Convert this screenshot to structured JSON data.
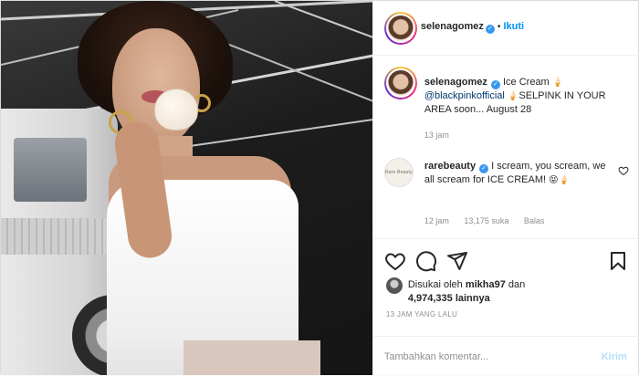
{
  "photo": {
    "alt_icon": "post-photo"
  },
  "header": {
    "username": "selenagomez",
    "verified_icon": "verified-badge-icon",
    "separator": "•",
    "follow_label": "Ikuti"
  },
  "caption": {
    "username": "selenagomez",
    "text_part1": "Ice Cream",
    "emoji1": "🍦",
    "mention": "@blackpinkofficial",
    "emoji2": "🍦",
    "text_part2": "SELPINK IN YOUR AREA soon... August 28",
    "time": "13 jam"
  },
  "comment": {
    "avatar_text": "Rare Beauty",
    "username": "rarebeauty",
    "text": "I scream, you scream, we all scream for ICE CREAM!",
    "emoji": "😝🍦",
    "time": "12 jam",
    "likes": "13,175 suka",
    "reply_label": "Balas"
  },
  "likes": {
    "prefix": "Disukai oleh",
    "user": "mikha97",
    "conjunction": "dan",
    "count": "4,974,335 lainnya"
  },
  "time_ago": "13 JAM YANG LALU",
  "add_comment": {
    "placeholder": "Tambahkan komentar...",
    "post_label": "Kirim"
  },
  "colors": {
    "accent": "#0095f6",
    "verified": "#3897f0",
    "post_disabled": "#b2dffc",
    "muted": "#8e8e8e",
    "text": "#262626"
  }
}
